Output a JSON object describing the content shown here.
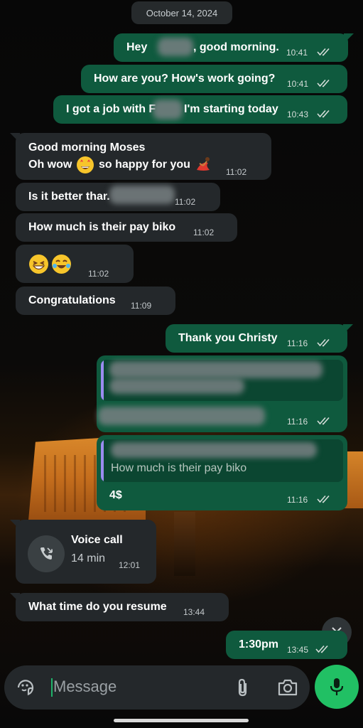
{
  "date_chip": "October 14, 2024",
  "messages": {
    "m1": {
      "before": "Hey",
      "after": ", good morning.",
      "time": "10:41"
    },
    "m2": {
      "text": "How are you? How's work going?",
      "time": "10:41"
    },
    "m3": {
      "before": "I got a job with F",
      "after": "I'm starting today",
      "time": "10:43"
    },
    "m4": {
      "line1": "Good morning Moses",
      "line2_before": "Oh wow",
      "line2_after": "so happy for you",
      "time": "11:02"
    },
    "m5": {
      "text": "Is it better thar.",
      "time": "11:02"
    },
    "m6": {
      "text": "How much is their pay biko",
      "time": "11:02"
    },
    "m7": {
      "time": "11:02"
    },
    "m8": {
      "text": "Congratulations",
      "time": "11:09"
    },
    "m9": {
      "text": "Thank you Christy",
      "time": "11:16"
    },
    "m10": {
      "time": "11:16"
    },
    "m11": {
      "quote": "How much is their pay biko",
      "text": "4$",
      "time": "11:16"
    },
    "voice_call": {
      "title": "Voice call",
      "duration": "14 min",
      "time": "12:01"
    },
    "m12": {
      "text": "What time do you resume",
      "time": "13:44"
    },
    "m13": {
      "text": "1:30pm",
      "time": "13:45"
    }
  },
  "input": {
    "placeholder": "Message"
  },
  "icons": {
    "sticker": "sticker-icon",
    "attach": "paperclip-icon",
    "camera": "camera-icon",
    "mic": "microphone-icon",
    "scroll": "double-chevron-down-icon",
    "call": "missed-call-icon"
  },
  "colors": {
    "outgoing_bubble": "#0f5a3e",
    "incoming_bubble": "#24282b",
    "mic_button": "#21c064",
    "quote_bar": "#9b8cf0"
  }
}
